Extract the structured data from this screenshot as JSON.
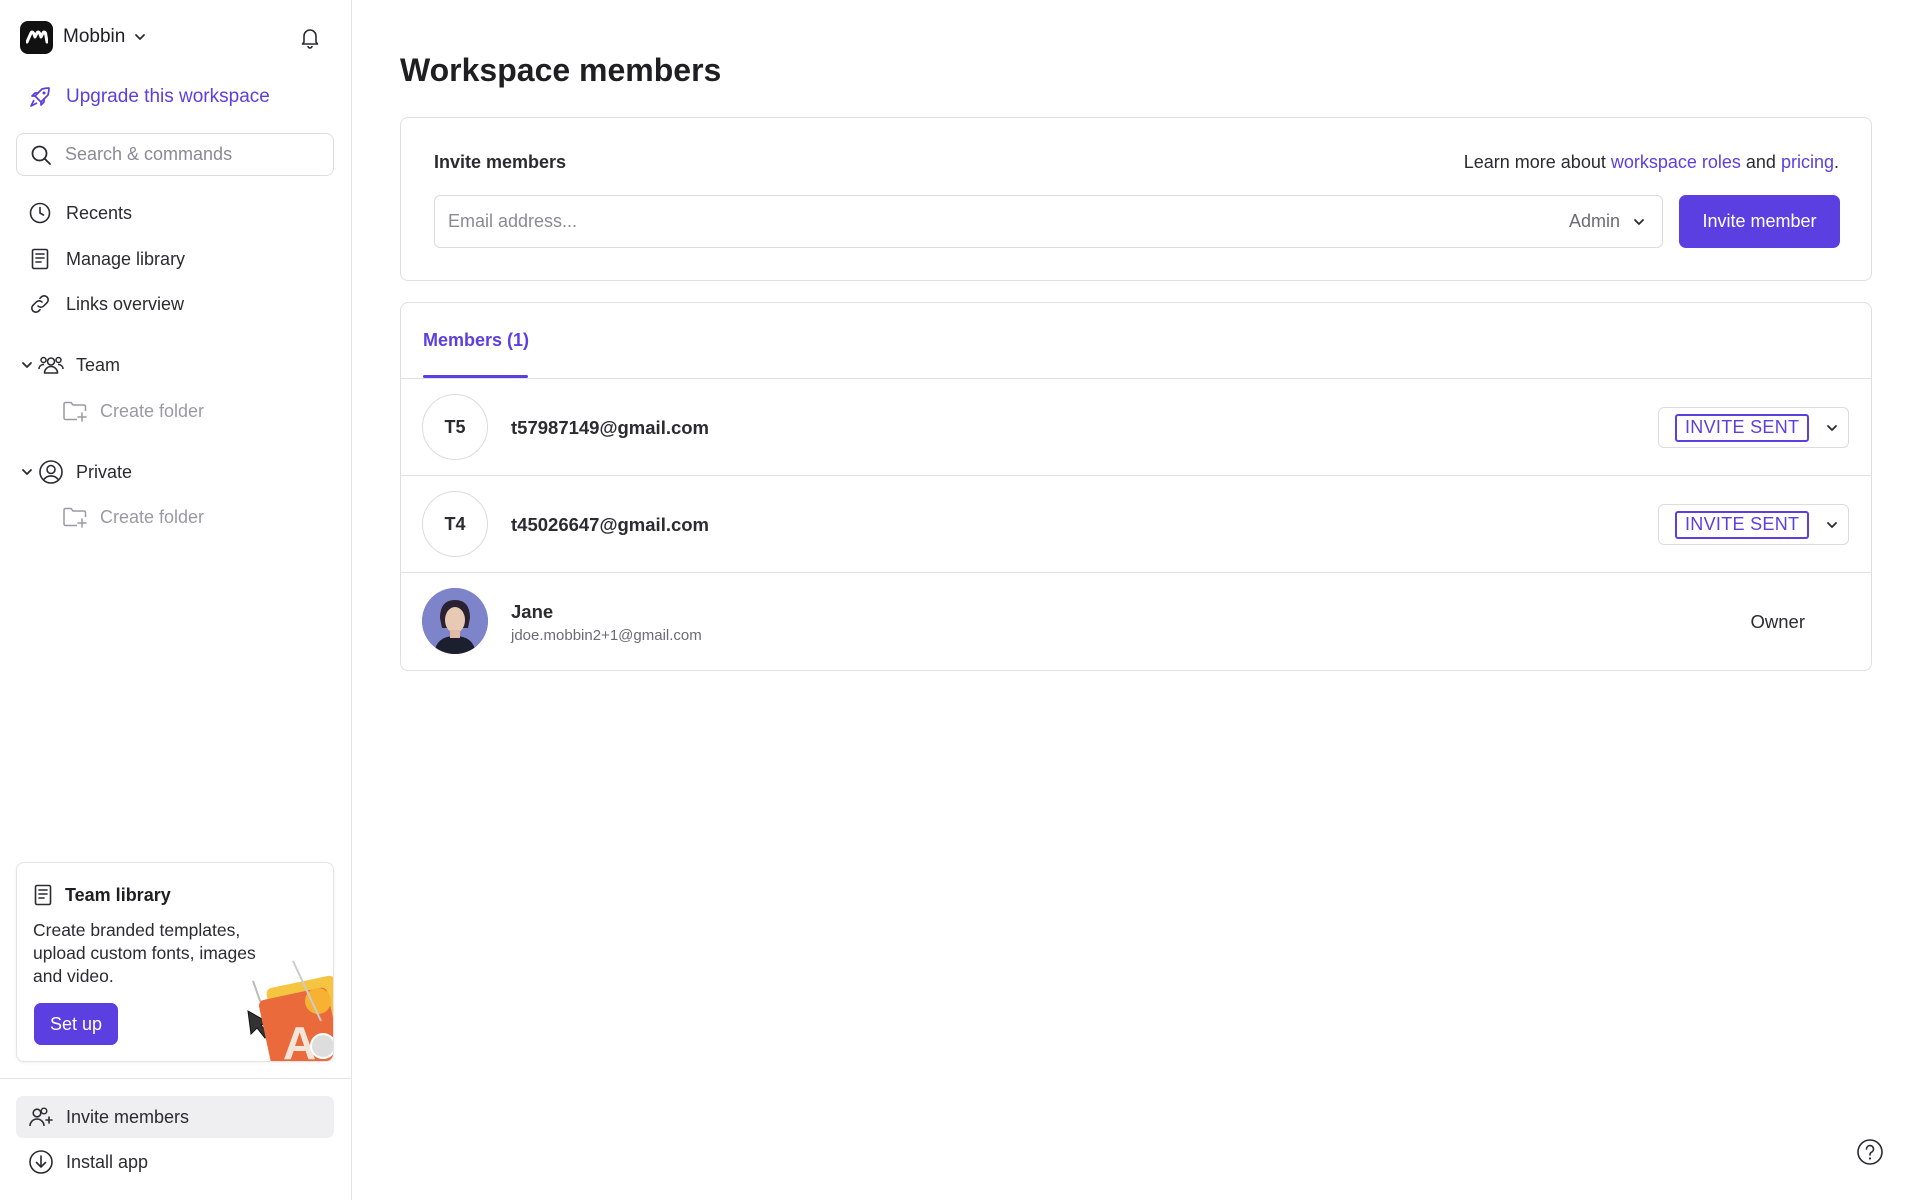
{
  "workspace": {
    "name": "Mobbin",
    "upgrade_label": "Upgrade this workspace"
  },
  "search": {
    "placeholder": "Search & commands"
  },
  "nav": {
    "recents": "Recents",
    "manage_library": "Manage library",
    "links_overview": "Links overview"
  },
  "sections": {
    "team": {
      "label": "Team",
      "create_folder": "Create folder"
    },
    "private": {
      "label": "Private",
      "create_folder": "Create folder"
    }
  },
  "promo": {
    "title": "Team library",
    "text": "Create branded templates, upload custom fonts, images and video.",
    "button": "Set up"
  },
  "bottom": {
    "invite_members": "Invite members",
    "install_app": "Install app"
  },
  "main": {
    "title": "Workspace members",
    "invite": {
      "label": "Invite members",
      "learn_prefix": "Learn more about ",
      "learn_link1": "workspace roles",
      "learn_mid": " and ",
      "learn_link2": "pricing",
      "learn_suffix": ".",
      "email_placeholder": "Email address...",
      "role": "Admin",
      "button": "Invite member"
    },
    "tab": "Members (1)",
    "members": [
      {
        "initials": "T5",
        "email": "t57987149@gmail.com",
        "status": "INVITE SENT"
      },
      {
        "initials": "T4",
        "email": "t45026647@gmail.com",
        "status": "INVITE SENT"
      },
      {
        "name": "Jane",
        "email": "jdoe.mobbin2+1@gmail.com",
        "role": "Owner"
      }
    ]
  },
  "colors": {
    "accent": "#5b3fe0",
    "border": "#e0e0e4",
    "text": "#1f1f23"
  }
}
